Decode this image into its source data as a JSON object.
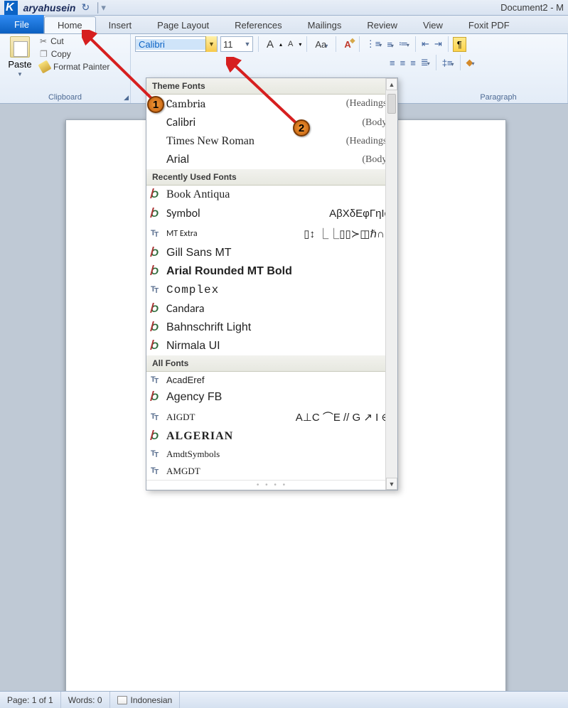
{
  "title_bar": {
    "brand_k": "K",
    "brand_rest": "aryahusein",
    "document": "Document2 - M"
  },
  "tabs": {
    "file": "File",
    "home": "Home",
    "insert": "Insert",
    "page_layout": "Page Layout",
    "references": "References",
    "mailings": "Mailings",
    "review": "Review",
    "view": "View",
    "foxit": "Foxit PDF"
  },
  "clipboard": {
    "paste": "Paste",
    "cut": "Cut",
    "copy": "Copy",
    "format_painter": "Format Painter",
    "label": "Clipboard"
  },
  "font": {
    "name": "Calibri",
    "size": "11",
    "grow": "A",
    "shrink": "A",
    "case": "Aa",
    "clear": "A"
  },
  "paragraph": {
    "label": "Paragraph"
  },
  "dropdown": {
    "theme_header": "Theme Fonts",
    "theme": [
      {
        "name": "Cambria",
        "suffix": "(Headings)",
        "ff": "Cambria,'Times New Roman',serif"
      },
      {
        "name": "Calibri",
        "suffix": "(Body)",
        "ff": "Calibri,Arial,sans-serif"
      },
      {
        "name": "Times New Roman",
        "suffix": "(Headings)",
        "ff": "'Times New Roman',serif"
      },
      {
        "name": "Arial",
        "suffix": "(Body)",
        "ff": "Arial,sans-serif"
      }
    ],
    "recent_header": "Recently Used Fonts",
    "recent": [
      {
        "name": "Book Antiqua",
        "icon": "ot",
        "ff": "'Book Antiqua','Palatino Linotype',serif"
      },
      {
        "name": "Symbol",
        "icon": "ot",
        "preview": "ΑβΧδΕφΓηΙϕ",
        "ff": "Calibri,Arial"
      },
      {
        "name": "MT Extra",
        "icon": "tt",
        "preview": "▯↕ ⎿⎿▯▯≻◫ℏ∩▯",
        "ff": "Calibri,Arial",
        "size": "12px"
      },
      {
        "name": "Gill Sans MT",
        "icon": "ot",
        "ff": "'Gill Sans MT','Gill Sans',sans-serif"
      },
      {
        "name": "Arial Rounded MT Bold",
        "icon": "ot",
        "ff": "'Arial Rounded MT Bold',Arial",
        "weight": "bold"
      },
      {
        "name": "Complex",
        "icon": "tt",
        "ff": "'Courier New',monospace",
        "ls": "1px"
      },
      {
        "name": "Candara",
        "icon": "ot",
        "ff": "Candara,Calibri,sans-serif"
      },
      {
        "name": "Bahnschrift Light",
        "icon": "ot",
        "ff": "Bahnschrift,'Arial Narrow',sans-serif",
        "weight": "300"
      },
      {
        "name": "Nirmala UI",
        "icon": "ot",
        "ff": "'Nirmala UI','Segoe UI',sans-serif"
      }
    ],
    "all_header": "All Fonts",
    "all": [
      {
        "name": "AcadEref",
        "icon": "tt",
        "ff": "Tahoma,sans-serif",
        "size": "13px"
      },
      {
        "name": "Agency FB",
        "icon": "ot",
        "ff": "'Agency FB','Arial Narrow',sans-serif"
      },
      {
        "name": "AIGDT",
        "icon": "tt",
        "preview": "A⊥C ⌒E // G ↗ I ⊕",
        "ff": "Tahoma",
        "size": "13px"
      },
      {
        "name": "ALGERIAN",
        "icon": "ot",
        "ff": "Algerian,'Wide Latin',serif",
        "weight": "bold",
        "ls": "1px"
      },
      {
        "name": "AmdtSymbols",
        "icon": "tt",
        "ff": "Tahoma",
        "size": "13px"
      },
      {
        "name": "AMGDT",
        "icon": "tt",
        "ff": "Tahoma",
        "size": "13px"
      }
    ]
  },
  "status": {
    "page": "Page: 1 of 1",
    "words": "Words: 0",
    "lang": "Indonesian"
  },
  "annot": {
    "one": "1",
    "two": "2"
  }
}
